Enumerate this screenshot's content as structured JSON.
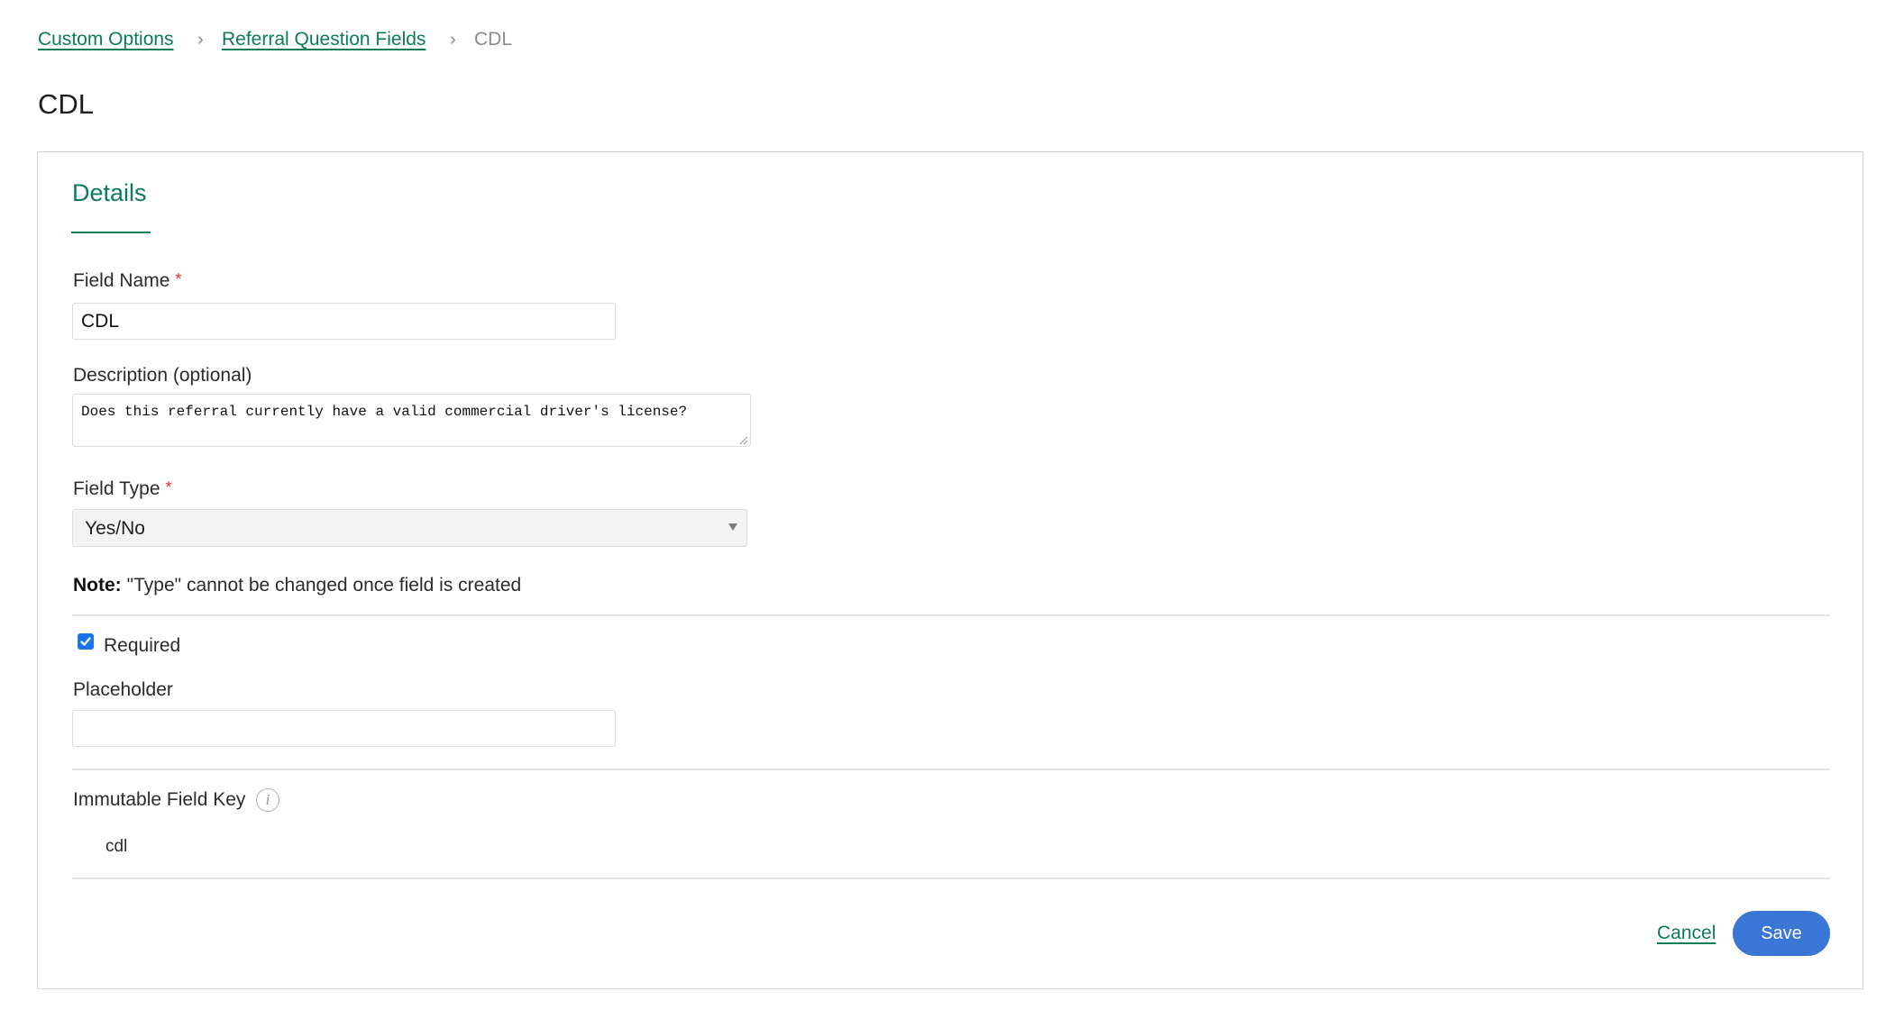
{
  "breadcrumb": {
    "items": [
      {
        "label": "Custom Options",
        "link": true
      },
      {
        "label": "Referral Question Fields",
        "link": true
      },
      {
        "label": "CDL",
        "link": false
      }
    ],
    "separator": "›"
  },
  "page_title": "CDL",
  "section": {
    "title": "Details"
  },
  "form": {
    "field_name": {
      "label": "Field Name",
      "required_mark": "*",
      "value": "CDL"
    },
    "description": {
      "label": "Description (optional)",
      "value": "Does this referral currently have a valid commercial driver's license?"
    },
    "field_type": {
      "label": "Field Type",
      "required_mark": "*",
      "selected": "Yes/No"
    },
    "note": {
      "prefix": "Note:",
      "text": "\"Type\" cannot be changed once field is created"
    },
    "required_checkbox": {
      "label": "Required",
      "checked": true
    },
    "placeholder": {
      "label": "Placeholder",
      "value": ""
    },
    "immutable_key": {
      "label": "Immutable Field Key",
      "info_icon": "info-icon",
      "info_glyph": "i",
      "value": "cdl"
    }
  },
  "actions": {
    "cancel_label": "Cancel",
    "save_label": "Save"
  },
  "colors": {
    "brand_green": "#0b7c58",
    "primary_blue": "#3a76d6",
    "required_red": "#e0342f"
  }
}
